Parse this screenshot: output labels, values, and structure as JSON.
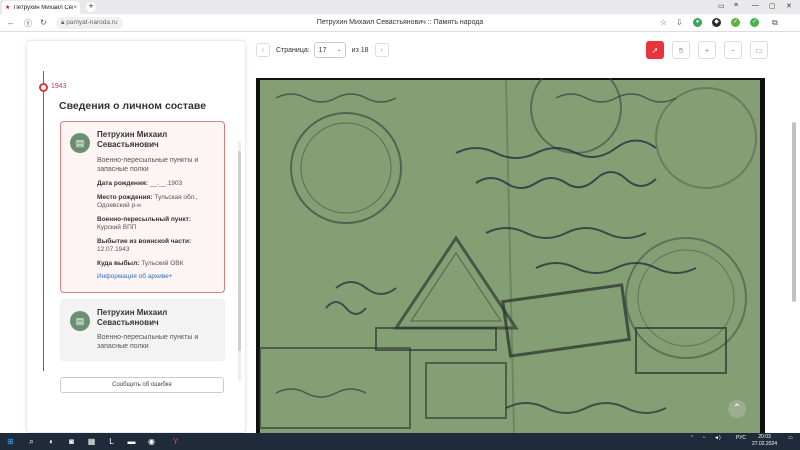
{
  "browser": {
    "tab_title": "Петрухин Михаил Севастьянович",
    "tab_close": "×",
    "new_tab": "+",
    "url": "pamyat-naroda.ru",
    "page_title": "Петрухин Михаил Севастьянович :: Память народа"
  },
  "timeline": {
    "year": "1943"
  },
  "section_title": "Сведения о личном составе",
  "cards": [
    {
      "name": "Петрухин Михаил Севастьянович",
      "subtitle": "Военно-пересыльные пункты и запасные полки",
      "birth_date_label": "Дата рождения:",
      "birth_date": "__.__.1903",
      "birth_place_label": "Место рождения:",
      "birth_place": "Тульская обл., Одоевский р-н",
      "vpp_label": "Военно-пересыльный пункт:",
      "vpp": "Курский ВПП",
      "departure_label": "Выбытие из воинской части:",
      "departure": "12.07.1943",
      "destination_label": "Куда выбыл:",
      "destination": "Тульский ОВК",
      "archive_link": "Информация об архиве+"
    },
    {
      "name": "Петрухин Михаил Севастьянович",
      "subtitle": "Военно-пересыльные пункты и запасные полки"
    }
  ],
  "report_button": "Сообщить об ошибке",
  "viewer": {
    "page_label": "Страница:",
    "page_current": "17",
    "page_total_label": "из 18",
    "accent_color": "#e8343c"
  },
  "taskbar": {
    "lang": "РУС",
    "time": "20:03",
    "date": "27.02.2024"
  }
}
